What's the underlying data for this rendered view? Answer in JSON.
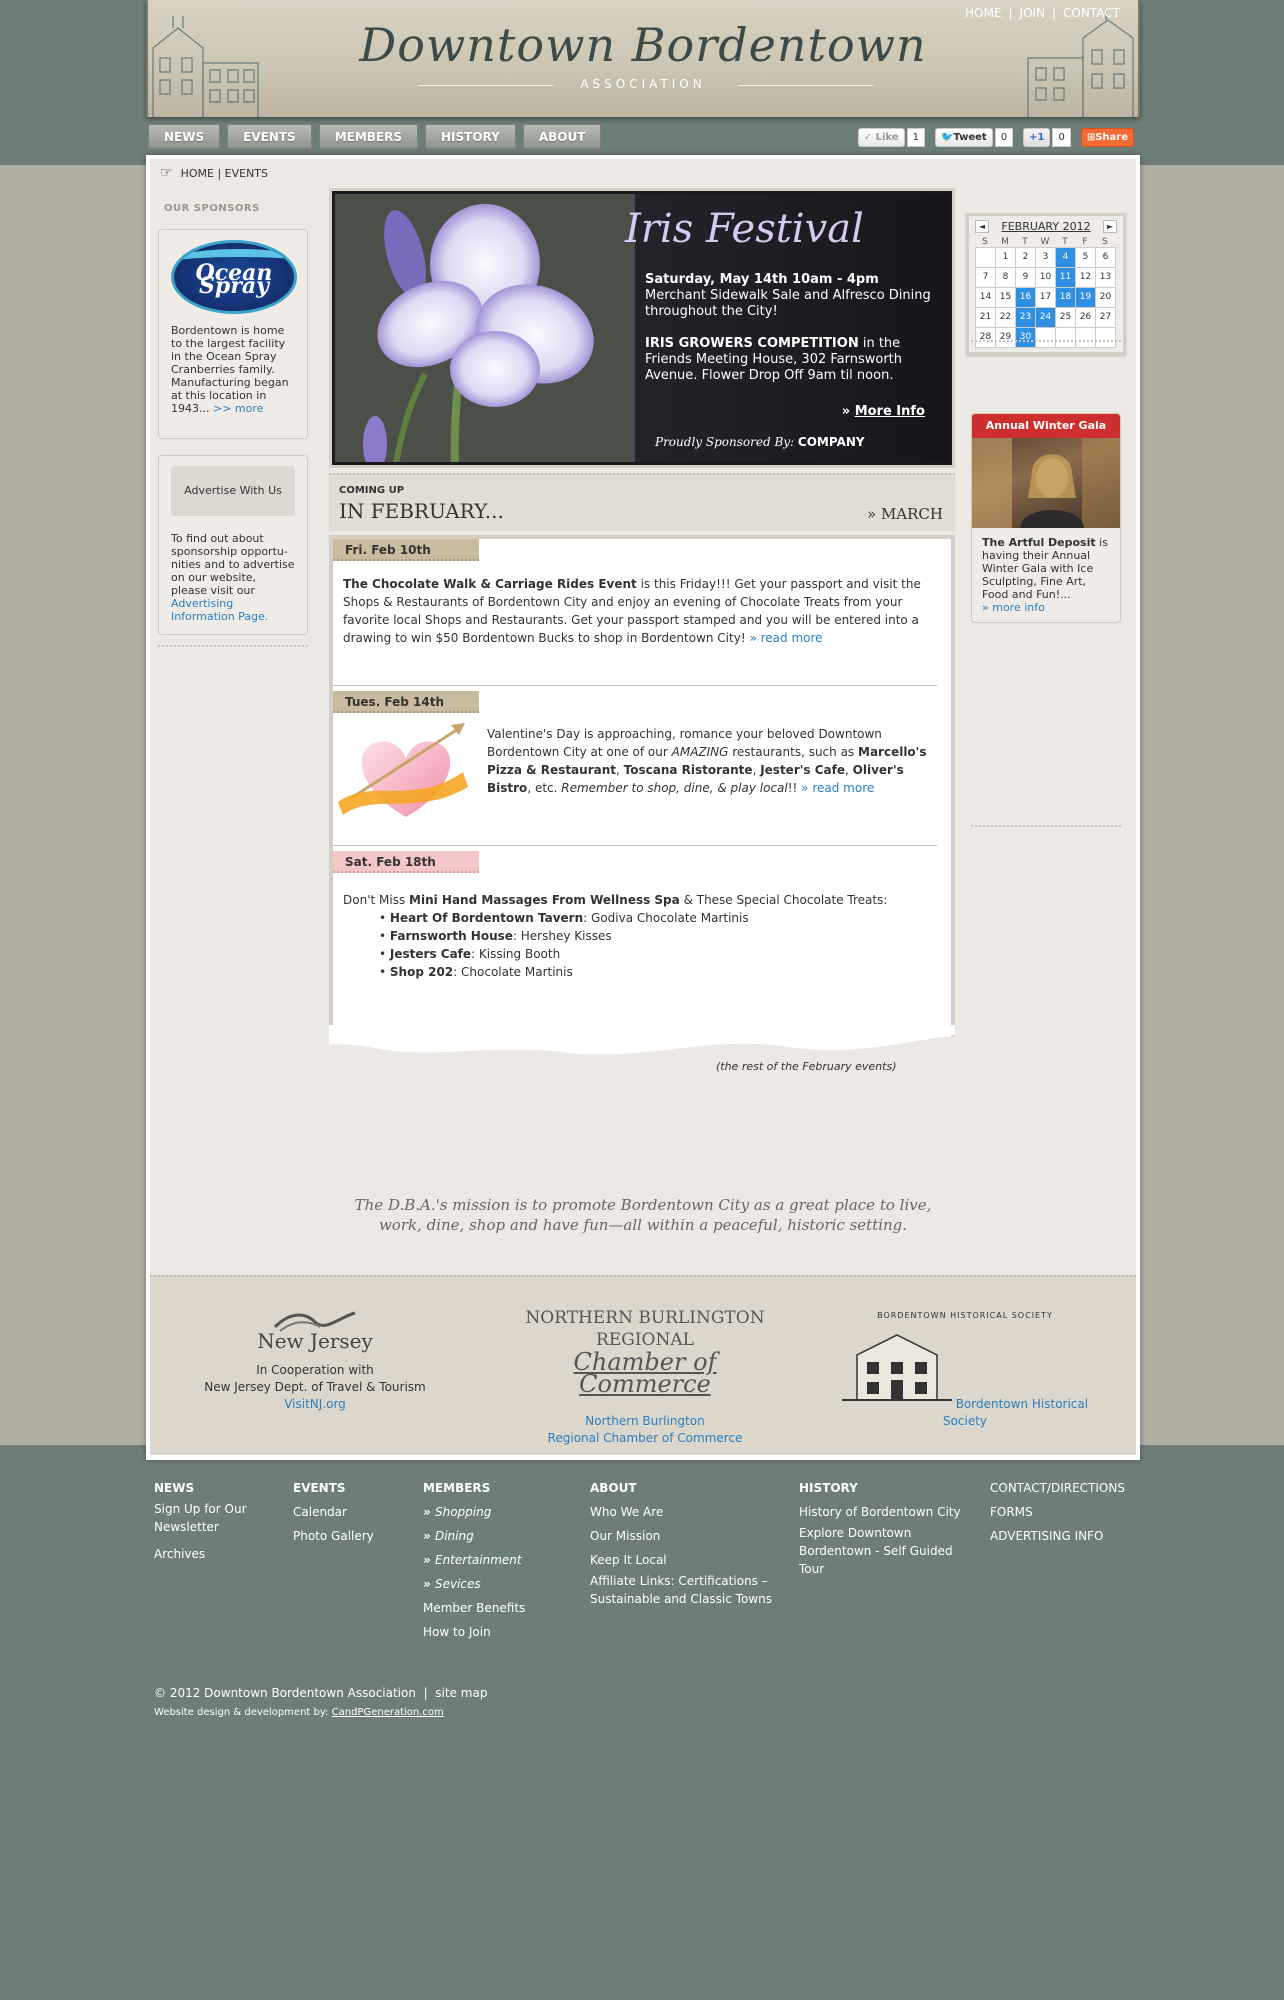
{
  "header": {
    "title": "Downtown Bordentown",
    "subtitle": "ASSOCIATION",
    "toplinks": [
      "HOME",
      "JOIN",
      "CONTACT"
    ]
  },
  "nav": [
    "NEWS",
    "EVENTS",
    "MEMBERS",
    "HISTORY",
    "ABOUT"
  ],
  "social": {
    "like_label": "Like",
    "like_count": "1",
    "tweet_label": "Tweet",
    "tweet_count": "0",
    "plus_label": "+1",
    "plus_count": "0",
    "share_label": "Share"
  },
  "breadcrumb": {
    "home": "HOME",
    "sep": "|",
    "current": "EVENTS"
  },
  "sponsors": {
    "heading": "OUR SPONSORS",
    "logo_text": "Ocean Spray",
    "blurb": "Bordentown is home to the largest facility in the Ocean Spray Cranberries family. Manufacturing began at this location in 1943...",
    "more": ">> more",
    "advertise_button": "Advertise With Us",
    "advertise_text": "To find out about sponsorship opportu-nities and to advertise on our website, please visit our",
    "advertise_link": "Advertising Information Page."
  },
  "hero": {
    "title": "Iris Festival",
    "line1": "Saturday, May 14th 10am - 4pm",
    "line2": "Merchant Sidewalk Sale and Alfresco Dining throughout the City!",
    "line3_bold": "IRIS GROWERS COMPETITION",
    "line3_rest": " in the Friends Meeting House, 302 Farnsworth Avenue. Flower Drop Off 9am til noon.",
    "more_info": "More Info",
    "sponsored_by": "Proudly Sponsored By:",
    "company": "COMPANY"
  },
  "coming": {
    "small": "COMING UP",
    "big": "IN FEBRUARY...",
    "next": "» MARCH"
  },
  "events": [
    {
      "date": "Fri. Feb 10th",
      "title": "The Chocolate Walk & Carriage Rides Event",
      "text": " is this Friday!!! Get your passport and visit the Shops & Restaurants of Bordentown City and enjoy an evening of Chocolate Treats from your favorite local Shops and Restaurants. Get your passport stamped and you will be entered into a drawing to win $50 Bordentown Bucks to shop in Bordentown City! ",
      "more": "» read more"
    },
    {
      "date": "Tues. Feb 14th",
      "t1": "Valentine's Day is approaching, romance your beloved Downtown Bordentown City at one of our ",
      "amazing": "AMAZING",
      "t2": " restaurants, such as ",
      "r1": "Marcello's Pizza & Restaurant",
      "r2": "Toscana Ristorante",
      "r3": "Jester's Cafe",
      "r4": "Oliver's Bistro",
      "t3": ", etc. ",
      "tagline": "Remember to shop, dine, & play local",
      "t4": "!! ",
      "more": "» read more"
    },
    {
      "date": "Sat. Feb 18th",
      "lead1": "Don't Miss ",
      "lead_bold": "Mini Hand Massages From Wellness Spa",
      "lead2": " & These Special Chocolate Treats:",
      "items": [
        {
          "name": "Heart Of Bordentown Tavern",
          "treat": ": Godiva Chocolate Martinis"
        },
        {
          "name": "Farnsworth House",
          "treat": ": Hershey Kisses"
        },
        {
          "name": "Jesters Cafe",
          "treat": ": Kissing Booth"
        },
        {
          "name": "Shop 202",
          "treat": ": Chocolate Martinis"
        }
      ]
    }
  ],
  "rest_note": "(the rest of the February events)",
  "calendar": {
    "title": "FEBRUARY 2012",
    "prev": "◄",
    "next": "►",
    "dow": [
      "S",
      "M",
      "T",
      "W",
      "T",
      "F",
      "S"
    ],
    "cells": [
      "",
      "1",
      "2",
      "3",
      "4",
      "5",
      "6",
      "7",
      "8",
      "9",
      "10",
      "11",
      "12",
      "13",
      "14",
      "15",
      "16",
      "17",
      "18",
      "19",
      "20",
      "21",
      "22",
      "23",
      "24",
      "25",
      "26",
      "27",
      "28",
      "29",
      "30"
    ],
    "highlighted": [
      "4",
      "11",
      "16",
      "18",
      "19",
      "23",
      "24",
      "30"
    ]
  },
  "gala": {
    "heading": "Annual Winter Gala",
    "title": "The Artful Deposit",
    "text": " is having their Annual Winter Gala with Ice Sculpting, Fine Art, Food and Fun!...",
    "more": "» more info"
  },
  "mission": {
    "line1": "The D.B.A.'s mission is to promote Bordentown City as a great place to live,",
    "line2": "work, dine, shop and have fun—all within a peaceful, historic setting."
  },
  "partners": {
    "nj_logo": "New Jersey",
    "nj_line1": "In Cooperation with",
    "nj_line2": "New Jersey Dept. of Travel & Tourism",
    "nj_link": "VisitNJ.org",
    "chamber_line1": "NORTHERN BURLINGTON REGIONAL",
    "chamber_line2": "Chamber of Commerce",
    "chamber_link1": "Northern Burlington",
    "chamber_link2": "Regional Chamber of Commerce",
    "hist_arc": "BORDENTOWN HISTORICAL SOCIETY",
    "hist_link": "Bordentown Historical Society"
  },
  "footer": {
    "news": {
      "h": "NEWS",
      "items": [
        "Sign Up for Our Newsletter",
        "Archives"
      ]
    },
    "events": {
      "h": "EVENTS",
      "items": [
        "Calendar",
        "Photo Gallery"
      ]
    },
    "members": {
      "h": "MEMBERS",
      "items": [
        "Shopping",
        "Dining",
        "Entertainment",
        "Sevices"
      ],
      "plain": [
        "Member Benefits",
        "How to Join"
      ]
    },
    "about": {
      "h": "ABOUT",
      "items": [
        "Who We Are",
        "Our Mission",
        "Keep It Local",
        "Affiliate Links: Certifications – Sustainable and Classic Towns"
      ]
    },
    "history": {
      "h": "HISTORY",
      "items": [
        "History of Bordentown City",
        "Explore Downtown Bordentown - Self Guided Tour"
      ]
    },
    "misc": {
      "items": [
        "CONTACT/DIRECTIONS",
        "FORMS",
        "ADVERTISING INFO"
      ]
    },
    "copyright": "© 2012 Downtown Bordentown Association",
    "sitemap": "site map",
    "credit_label": "Website design & development by:",
    "credit_link": "CandPGeneration.com"
  }
}
